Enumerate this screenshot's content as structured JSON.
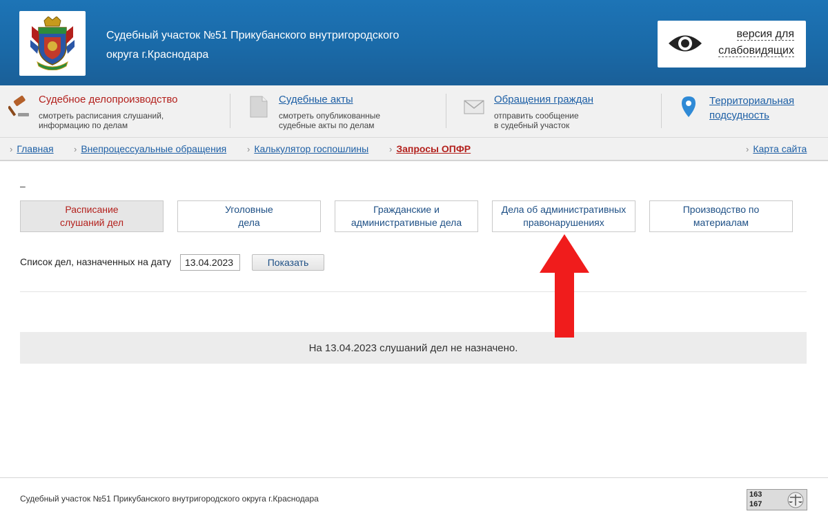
{
  "header": {
    "title_line1": "Судебный участок №51 Прикубанского внутригородского",
    "title_line2": "округа г.Краснодара",
    "vision_line1": "версия для",
    "vision_line2": "слабовидящих"
  },
  "services": [
    {
      "title": "Судебное делопроизводство",
      "desc1": "смотреть расписания слушаний,",
      "desc2": "информацию по делам",
      "icon": "gavel-icon"
    },
    {
      "title": "Судебные акты",
      "desc1": "смотреть опубликованные",
      "desc2": "судебные акты по делам",
      "icon": "document-icon"
    },
    {
      "title": "Обращения граждан",
      "desc1": "отправить сообщение",
      "desc2": "в судебный участок",
      "icon": "envelope-icon"
    },
    {
      "title": "Территориальная",
      "title2": "подсудность",
      "icon": "map-pin-icon"
    }
  ],
  "breadcrumbs": [
    {
      "label": "Главная"
    },
    {
      "label": "Внепроцессуальные обращения"
    },
    {
      "label": "Калькулятор госпошлины"
    },
    {
      "label": "Запросы ОПФР"
    }
  ],
  "sitemap_label": "Карта сайта",
  "dash": "–",
  "tabs": [
    {
      "line1": "Расписание",
      "line2": "слушаний дел"
    },
    {
      "line1": "Уголовные",
      "line2": "дела"
    },
    {
      "line1": "Гражданские и",
      "line2": "административные дела"
    },
    {
      "line1": "Дела об административных",
      "line2": "правонарушениях"
    },
    {
      "line1": "Производство по",
      "line2": "материалам"
    }
  ],
  "date_form": {
    "label": "Список дел, назначенных на дату",
    "value": "13.04.2023",
    "button": "Показать"
  },
  "notice": "На 13.04.2023 слушаний дел не назначено.",
  "footer": {
    "text": "Судебный участок №51 Прикубанского внутригородского округа г.Краснодара",
    "counter1": "163",
    "counter2": "167"
  },
  "colors": {
    "header_blue": "#1a6aa8",
    "active_red": "#b3201c",
    "link_blue": "#1d5fa5",
    "arrow_red": "#f01c1c"
  }
}
